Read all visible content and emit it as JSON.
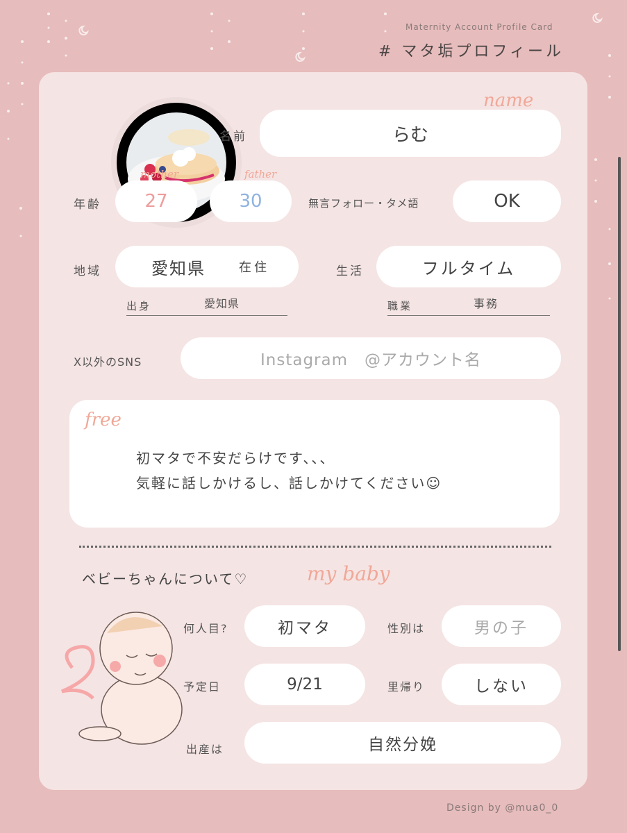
{
  "header": {
    "subtitle": "Maternity Account Profile Card",
    "title": "# マタ垢プロフィール"
  },
  "profile": {
    "name_script": "name",
    "name_label": "名前",
    "name_value": "らむ",
    "age_label": "年齢",
    "mother_script": "mother",
    "mother_age": "27",
    "father_script": "father",
    "father_age": "30",
    "follow_label": "無言フォロー・タメ語",
    "follow_value": "OK",
    "region_label": "地域",
    "region_value": "愛知県",
    "region_suffix": "在住",
    "origin_label": "出身",
    "origin_value": "愛知県",
    "life_label": "生活",
    "life_value": "フルタイム",
    "job_label": "職業",
    "job_value": "事務",
    "sns_label": "X以外のSNS",
    "sns_value": "Instagram　@アカウント名"
  },
  "free": {
    "script": "free",
    "line1": "初マタで不安だらけです、、、",
    "line2": "気軽に話しかけるし、話しかけてください☺"
  },
  "baby": {
    "heading": "ベビーちゃんについて♡",
    "heading_script": "my baby",
    "order_label": "何人目?",
    "order_value": "初マタ",
    "gender_label": "性別は",
    "gender_value": "男の子",
    "due_label": "予定日",
    "due_value": "9/21",
    "return_label": "里帰り",
    "return_value": "しない",
    "birth_label": "出産は",
    "birth_value": "自然分娩"
  },
  "footer": {
    "credit": "Design by @mua0_0"
  },
  "colors": {
    "background": "#e7bcbc",
    "card": "#f5e4e4",
    "mother": "#ee9c9c",
    "father": "#8fb3de",
    "script": "#f0a898"
  }
}
